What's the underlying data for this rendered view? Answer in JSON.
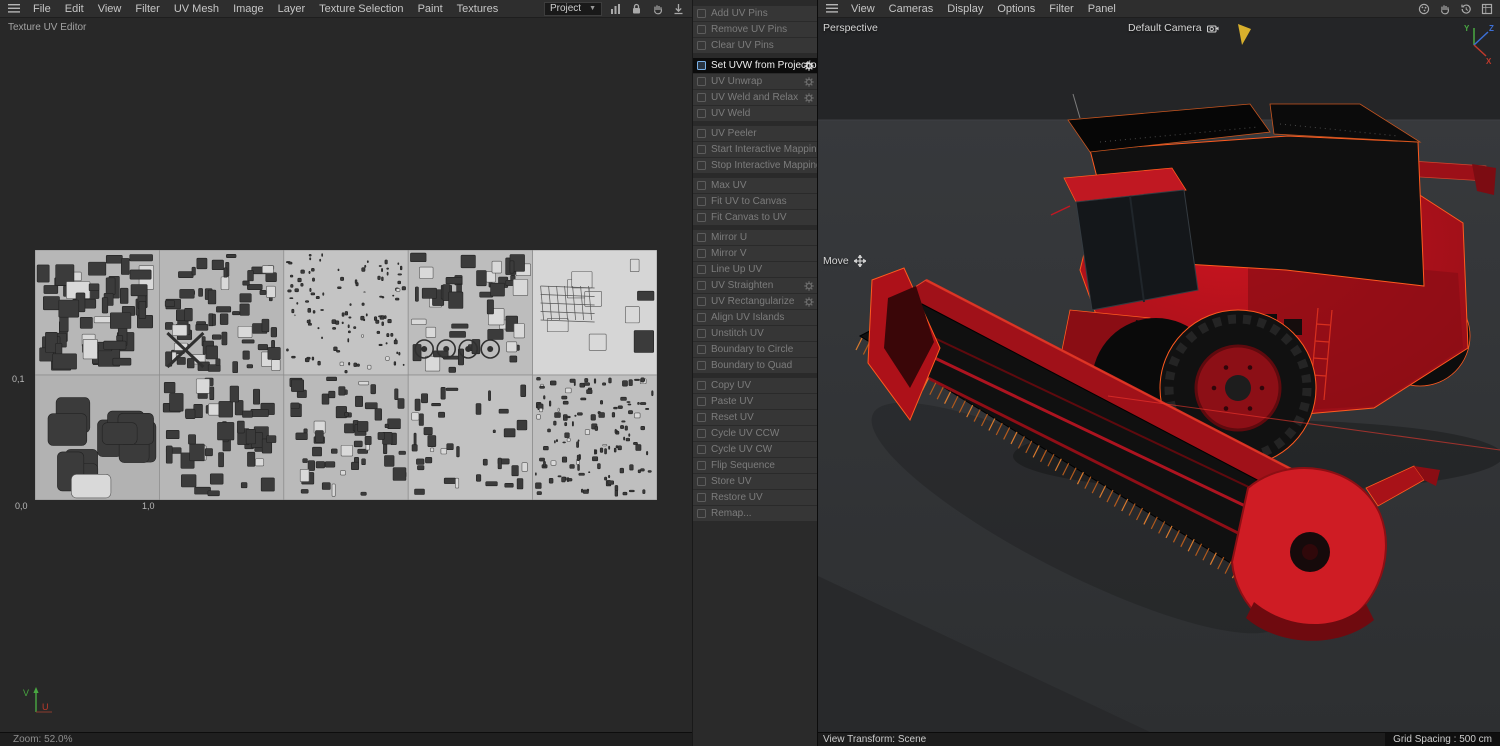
{
  "uv_editor": {
    "title": "Texture UV Editor",
    "menubar": [
      "File",
      "Edit",
      "View",
      "Filter",
      "UV Mesh",
      "Image",
      "Layer",
      "Texture Selection",
      "Paint",
      "Textures"
    ],
    "project_dropdown": {
      "value": "Project"
    },
    "toolbar_icons": [
      "histogram-icon",
      "lock-icon",
      "hand-icon",
      "download-icon"
    ],
    "coords": {
      "top_left": "0,1",
      "origin": "0,0",
      "right": "1,0"
    },
    "axes": {
      "u": "U",
      "v": "V"
    },
    "status": "Zoom: 52.0%"
  },
  "commands": {
    "groups": [
      {
        "items": [
          {
            "label": "Add UV Pins"
          },
          {
            "label": "Remove UV Pins"
          },
          {
            "label": "Clear UV Pins"
          }
        ]
      },
      {
        "items": [
          {
            "label": "Set UVW from Projection",
            "selected": true,
            "gear": true
          },
          {
            "label": "UV Unwrap",
            "gear": true
          },
          {
            "label": "UV Weld and Relax",
            "gear": true
          },
          {
            "label": "UV Weld"
          }
        ]
      },
      {
        "items": [
          {
            "label": "UV Peeler"
          },
          {
            "label": "Start Interactive Mapping"
          },
          {
            "label": "Stop Interactive Mapping"
          }
        ]
      },
      {
        "items": [
          {
            "label": "Max UV"
          },
          {
            "label": "Fit UV to Canvas"
          },
          {
            "label": "Fit Canvas to UV"
          }
        ]
      },
      {
        "items": [
          {
            "label": "Mirror U"
          },
          {
            "label": "Mirror V"
          },
          {
            "label": "Line Up UV"
          },
          {
            "label": "UV Straighten",
            "gear": true
          },
          {
            "label": "UV Rectangularize",
            "gear": true
          },
          {
            "label": "Align UV Islands"
          },
          {
            "label": "Unstitch UV"
          },
          {
            "label": "Boundary to Circle"
          },
          {
            "label": "Boundary to Quad"
          }
        ]
      },
      {
        "items": [
          {
            "label": "Copy UV"
          },
          {
            "label": "Paste UV"
          },
          {
            "label": "Reset UV"
          },
          {
            "label": "Cycle UV CCW"
          },
          {
            "label": "Cycle UV CW"
          },
          {
            "label": "Flip Sequence"
          },
          {
            "label": "Store UV"
          },
          {
            "label": "Restore UV"
          },
          {
            "label": "Remap..."
          }
        ]
      }
    ]
  },
  "viewport": {
    "menubar": [
      "View",
      "Cameras",
      "Display",
      "Options",
      "Filter",
      "Panel"
    ],
    "view_label": "Perspective",
    "camera_label": "Default Camera",
    "tool_label": "Move",
    "status_left": "View Transform: Scene",
    "status_right": "Grid Spacing : 500 cm",
    "axis_labels": {
      "x": "X",
      "y": "Y",
      "z": "Z"
    },
    "toolbar_icons": [
      "palette-icon",
      "hand-icon",
      "history-icon",
      "layout-icon"
    ]
  },
  "colors": {
    "selection_outline": "#ff5a1f",
    "harvester_red": "#b51320",
    "axis_u_red": "#c0392b",
    "axis_v_green": "#49a942"
  }
}
